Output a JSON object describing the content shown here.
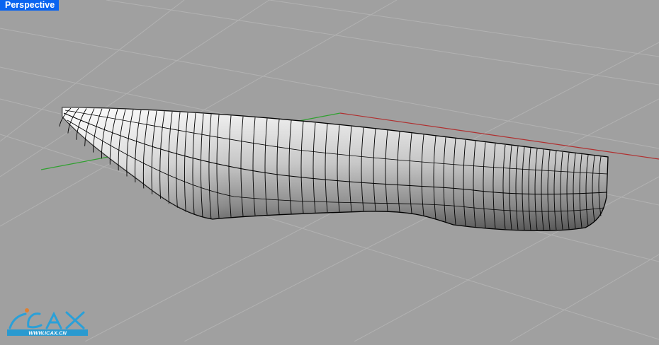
{
  "viewport": {
    "title": "Perspective",
    "background_color": "#a0a0a0",
    "grid_color": "#b2b2b2",
    "x_axis_color": "#b03030",
    "y_axis_color": "#30a030"
  },
  "watermark": {
    "logo_text": "ICAX",
    "url_text": "WWW.ICAX.CN"
  },
  "model": {
    "object": "boat hull surface",
    "icon": "nurbs-surface"
  }
}
